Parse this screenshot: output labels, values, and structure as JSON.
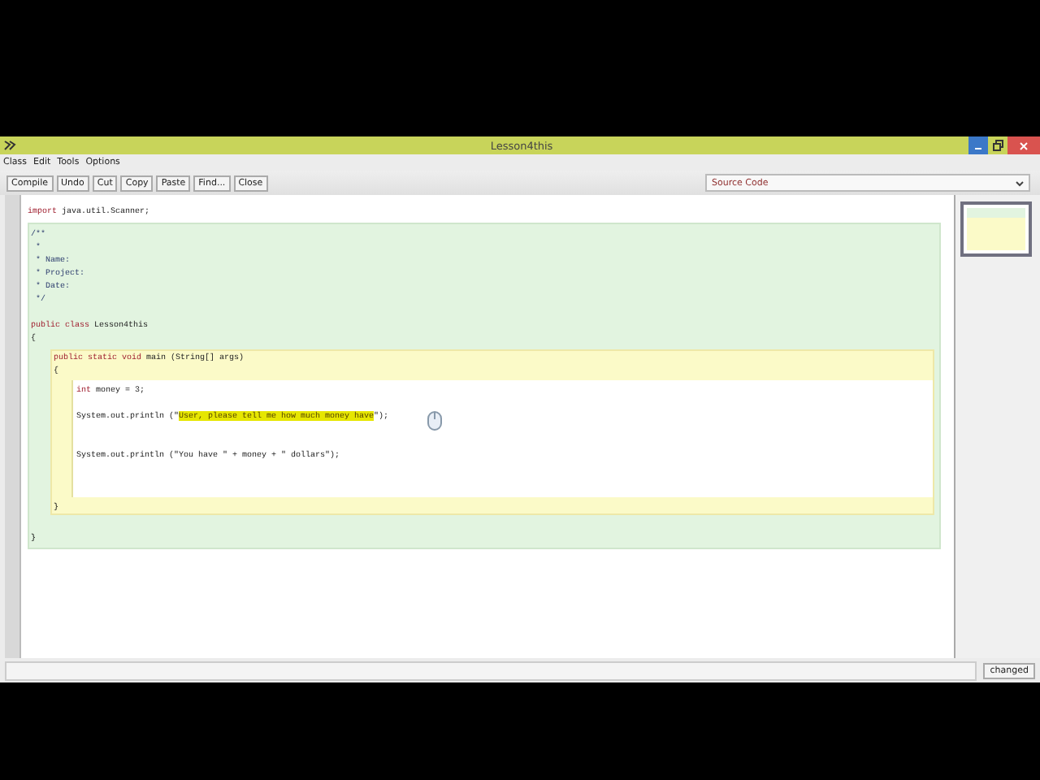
{
  "window": {
    "title": "Lesson4this"
  },
  "menu": [
    "Class",
    "Edit",
    "Tools",
    "Options"
  ],
  "toolbar": [
    "Compile",
    "Undo",
    "Cut",
    "Copy",
    "Paste",
    "Find...",
    "Close"
  ],
  "view_select": {
    "value": "Source Code"
  },
  "code": {
    "header": [
      {
        "tokens": [
          {
            "text": "import",
            "kind": "keyword"
          },
          {
            "text": " java.util.Scanner;",
            "kind": "plain"
          }
        ]
      }
    ],
    "comment": [
      {
        "tokens": [
          {
            "text": "/**",
            "kind": "comment"
          }
        ]
      },
      {
        "tokens": [
          {
            "text": " *",
            "kind": "comment"
          }
        ]
      },
      {
        "tokens": [
          {
            "text": " * Name:",
            "kind": "comment"
          }
        ]
      },
      {
        "tokens": [
          {
            "text": " * Project:",
            "kind": "comment"
          }
        ]
      },
      {
        "tokens": [
          {
            "text": " * Date:",
            "kind": "comment"
          }
        ]
      },
      {
        "tokens": [
          {
            "text": " */",
            "kind": "comment"
          }
        ]
      }
    ],
    "class_signature": [
      {
        "tokens": [
          {
            "text": "public class",
            "kind": "keyword"
          },
          {
            "text": " Lesson4this",
            "kind": "plain"
          }
        ]
      },
      {
        "tokens": [
          {
            "text": "{",
            "kind": "plain"
          }
        ]
      }
    ],
    "method_signature": [
      {
        "tokens": [
          {
            "text": "public static void",
            "kind": "keyword"
          },
          {
            "text": " main (String[] args)",
            "kind": "plain"
          }
        ]
      },
      {
        "tokens": [
          {
            "text": "{",
            "kind": "plain"
          }
        ]
      }
    ],
    "body": [
      {
        "tokens": [
          {
            "text": "int",
            "kind": "keyword"
          },
          {
            "text": " money = 3;",
            "kind": "plain"
          }
        ]
      },
      {
        "tokens": [
          {
            "text": "System.out.println (\"",
            "kind": "plain"
          },
          {
            "text": "User, please tell me how much money have",
            "kind": "selected"
          },
          {
            "text": "\");",
            "kind": "plain"
          }
        ]
      },
      {
        "tokens": [
          {
            "text": "System.out.println (\"You have \" + money + \" dollars\");",
            "kind": "plain"
          }
        ]
      }
    ],
    "method_close": "}",
    "class_close": "}"
  },
  "status": {
    "button": "changed"
  }
}
